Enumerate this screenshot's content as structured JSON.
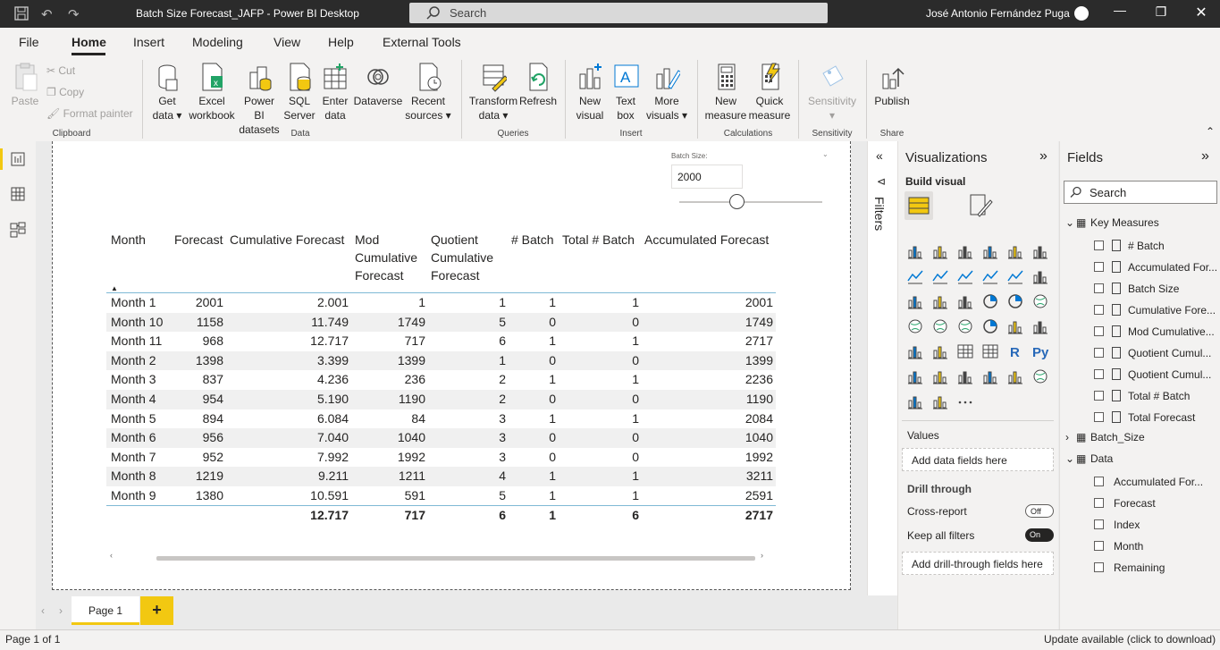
{
  "titlebar": {
    "title": "Batch Size Forecast_JAFP - Power BI Desktop",
    "search_placeholder": "Search",
    "user": "José Antonio Fernández Puga"
  },
  "menu": [
    "File",
    "Home",
    "Insert",
    "Modeling",
    "View",
    "Help",
    "External Tools"
  ],
  "ribbon": {
    "clipboard": {
      "paste": "Paste",
      "cut": "Cut",
      "copy": "Copy",
      "format_painter": "Format painter",
      "label": "Clipboard"
    },
    "data": {
      "get_data_1": "Get",
      "get_data_2": "data",
      "excel_1": "Excel",
      "excel_2": "workbook",
      "pbi_1": "Power BI",
      "pbi_2": "datasets",
      "sql_1": "SQL",
      "sql_2": "Server",
      "enter_1": "Enter",
      "enter_2": "data",
      "dataverse": "Dataverse",
      "recent_1": "Recent",
      "recent_2": "sources",
      "label": "Data"
    },
    "queries": {
      "transform_1": "Transform",
      "transform_2": "data",
      "refresh": "Refresh",
      "label": "Queries"
    },
    "insert": {
      "newvis_1": "New",
      "newvis_2": "visual",
      "text_1": "Text",
      "text_2": "box",
      "more_1": "More",
      "more_2": "visuals",
      "label": "Insert"
    },
    "calculations": {
      "newm_1": "New",
      "newm_2": "measure",
      "quick_1": "Quick",
      "quick_2": "measure",
      "label": "Calculations"
    },
    "sensitivity": {
      "btn": "Sensitivity",
      "label": "Sensitivity"
    },
    "share": {
      "publish": "Publish",
      "label": "Share"
    }
  },
  "slicer": {
    "label": "Batch Size:",
    "value": "2000",
    "level": 0.4
  },
  "table": {
    "headers": [
      "Month",
      "Forecast",
      "Cumulative Forecast",
      "Mod Cumulative Forecast",
      "Quotient Cumulative Forecast",
      "# Batch",
      "Total # Batch",
      "Accumulated Forecast"
    ],
    "header_lines": {
      "mod": [
        "Mod",
        "Cumulative",
        "Forecast"
      ],
      "quot": [
        "Quotient",
        "Cumulative",
        "Forecast"
      ]
    },
    "rows": [
      [
        "Month 1",
        "2001",
        "2.001",
        "1",
        "1",
        "1",
        "1",
        "2001"
      ],
      [
        "Month 10",
        "1158",
        "11.749",
        "1749",
        "5",
        "0",
        "0",
        "1749"
      ],
      [
        "Month 11",
        "968",
        "12.717",
        "717",
        "6",
        "1",
        "1",
        "2717"
      ],
      [
        "Month 2",
        "1398",
        "3.399",
        "1399",
        "1",
        "0",
        "0",
        "1399"
      ],
      [
        "Month 3",
        "837",
        "4.236",
        "236",
        "2",
        "1",
        "1",
        "2236"
      ],
      [
        "Month 4",
        "954",
        "5.190",
        "1190",
        "2",
        "0",
        "0",
        "1190"
      ],
      [
        "Month 5",
        "894",
        "6.084",
        "84",
        "3",
        "1",
        "1",
        "2084"
      ],
      [
        "Month 6",
        "956",
        "7.040",
        "1040",
        "3",
        "0",
        "0",
        "1040"
      ],
      [
        "Month 7",
        "952",
        "7.992",
        "1992",
        "3",
        "0",
        "0",
        "1992"
      ],
      [
        "Month 8",
        "1219",
        "9.211",
        "1211",
        "4",
        "1",
        "1",
        "3211"
      ],
      [
        "Month 9",
        "1380",
        "10.591",
        "591",
        "5",
        "1",
        "1",
        "2591"
      ]
    ],
    "totals": [
      "",
      "",
      "12.717",
      "717",
      "6",
      "1",
      "6",
      "2717"
    ]
  },
  "filters": {
    "label": "Filters"
  },
  "visualizations": {
    "title": "Visualizations",
    "build": "Build visual",
    "values_label": "Values",
    "values_well": "Add data fields here",
    "drill_title": "Drill through",
    "cross_report": "Cross-report",
    "cross_state": "Off",
    "keep_filters": "Keep all filters",
    "keep_state": "On",
    "drill_well": "Add drill-through fields here"
  },
  "fields": {
    "title": "Fields",
    "search_placeholder": "Search",
    "tables": [
      {
        "name": "Key Measures",
        "items": [
          "# Batch",
          "Accumulated For...",
          "Batch Size",
          "Cumulative Fore...",
          "Mod Cumulative...",
          "Quotient Cumul...",
          "Quotient Cumul...",
          "Total # Batch",
          "Total Forecast"
        ]
      },
      {
        "name": "Batch_Size",
        "items": []
      },
      {
        "name": "Data",
        "items": [
          "Accumulated For...",
          "Forecast",
          "Index",
          "Month",
          "Remaining"
        ]
      }
    ]
  },
  "pages": {
    "tab": "Page 1",
    "add": "+"
  },
  "status": {
    "left": "Page 1 of 1",
    "right": "Update available (click to download)"
  }
}
